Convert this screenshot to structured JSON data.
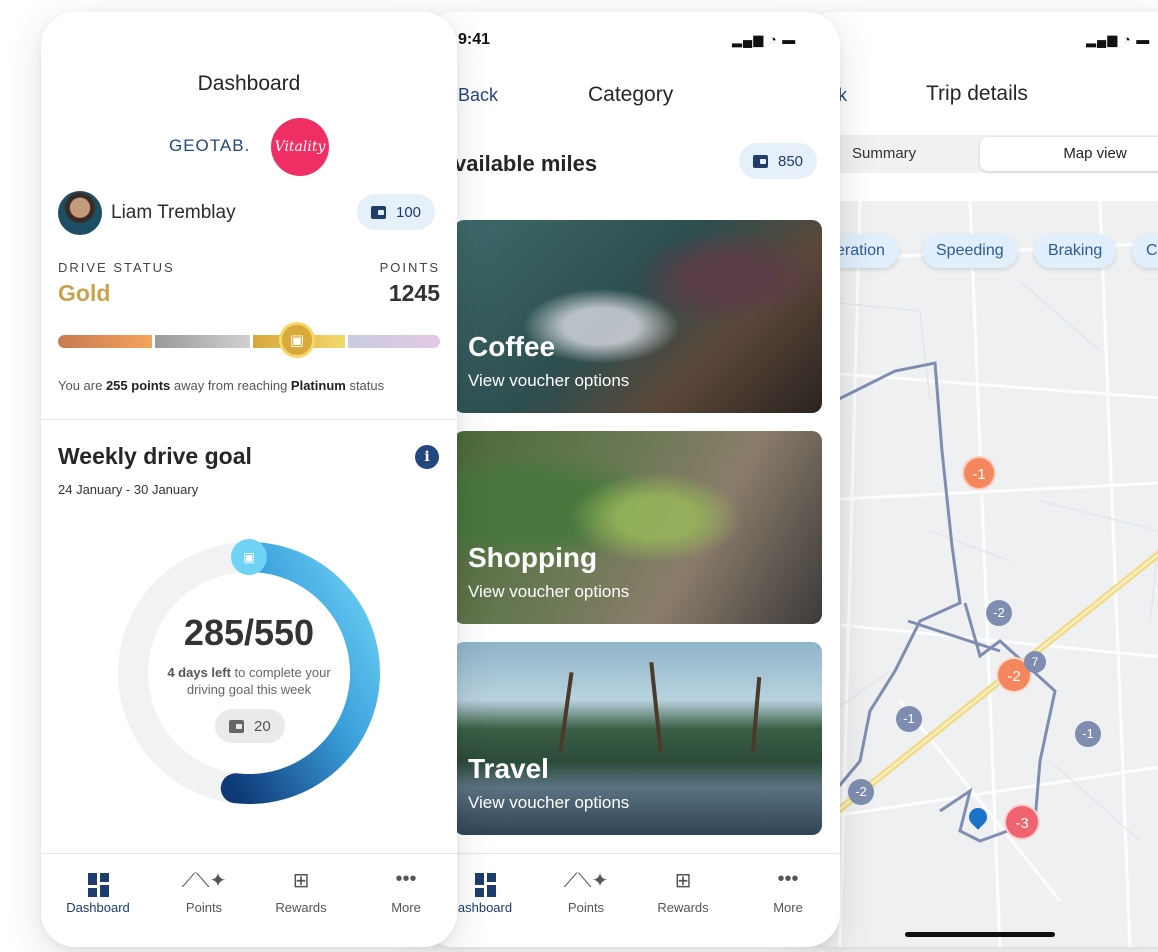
{
  "screen1": {
    "title": "Dashboard",
    "brand": "GEOTAB.",
    "partner_logo": "Vitality",
    "user_name": "Liam Tremblay",
    "wallet_points": "100",
    "drive_status_label": "DRIVE STATUS",
    "drive_status_value": "Gold",
    "points_label": "POINTS",
    "points_value": "1245",
    "status_prefix": "You are ",
    "status_points": "255 points",
    "status_middle": " away from reaching ",
    "status_tier": "Platinum",
    "status_suffix": " status",
    "goal_title": "Weekly drive goal",
    "goal_dates": "24 January - 30 January",
    "goal_progress_text": "285/550",
    "goal_current": 285,
    "goal_target": 550,
    "days_left": "4 days left",
    "days_left_suffix": " to complete your driving goal this week",
    "goal_reward": "20",
    "tabs": [
      {
        "label": "Dashboard",
        "icon": "dashboard-icon",
        "active": true
      },
      {
        "label": "Points",
        "icon": "points-icon",
        "active": false
      },
      {
        "label": "Rewards",
        "icon": "rewards-icon",
        "active": false
      },
      {
        "label": "More",
        "icon": "more-icon",
        "active": false
      }
    ]
  },
  "screen2": {
    "time": "9:41",
    "back_label": "Back",
    "title": "Category",
    "available_label": "vailable miles",
    "miles": "850",
    "cards": [
      {
        "title": "Coffee",
        "subtitle": "View voucher options"
      },
      {
        "title": "Shopping",
        "subtitle": "View voucher options"
      },
      {
        "title": "Travel",
        "subtitle": "View voucher options"
      }
    ],
    "tabs": [
      {
        "label": "ashboard",
        "icon": "dashboard-icon",
        "active": true
      },
      {
        "label": "Points",
        "icon": "points-icon",
        "active": false
      },
      {
        "label": "Rewards",
        "icon": "rewards-icon",
        "active": false
      },
      {
        "label": "More",
        "icon": "more-icon",
        "active": false
      }
    ]
  },
  "screen3": {
    "back_label": "k",
    "title": "Trip details",
    "segments": [
      "Summary",
      "Map view"
    ],
    "active_segment": "Map view",
    "filters": [
      "eration",
      "Speeding",
      "Braking",
      "C"
    ],
    "markers": [
      {
        "label": "-1",
        "severity": "high"
      },
      {
        "label": "-2",
        "severity": "low"
      },
      {
        "label": "-2",
        "severity": "high"
      },
      {
        "label": "7",
        "severity": "low"
      },
      {
        "label": "-1",
        "severity": "low"
      },
      {
        "label": "-1",
        "severity": "low"
      },
      {
        "label": "-2",
        "severity": "low"
      },
      {
        "label": "-3",
        "severity": "severe"
      }
    ]
  },
  "colors": {
    "primary": "#1d3d6e",
    "gold": "#c9a24c",
    "chip_bg": "#e6f0fb",
    "accent_pink": "#ef2e63",
    "ring_start": "#0f3a78",
    "ring_end": "#6fd3f5",
    "marker_high": "#f5875e",
    "marker_severe": "#f06470",
    "marker_low": "#7f8eb0"
  }
}
